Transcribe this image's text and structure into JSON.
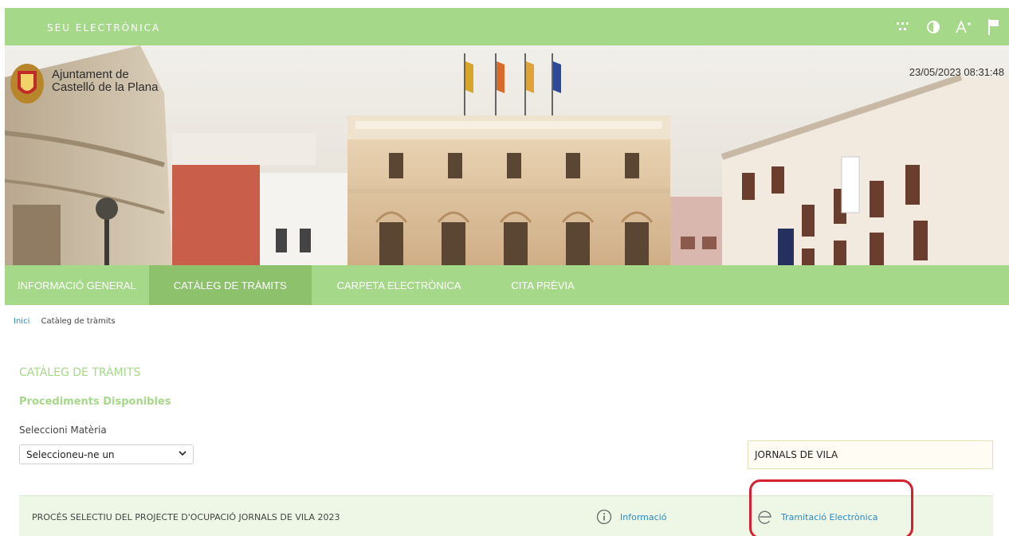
{
  "topbar": {
    "title": "SEU ELECTRÒNICA",
    "icons": [
      "sitemap-icon",
      "contrast-icon",
      "font-size-icon",
      "flag-icon"
    ],
    "color": "#a6d889"
  },
  "banner": {
    "logo_line1": "Ajuntament de",
    "logo_line2": "Castelló de la Plana",
    "datetime": "23/05/2023 08:31:48"
  },
  "nav": {
    "items": [
      {
        "label": "INFORMACIÓ GENERAL",
        "active": false
      },
      {
        "label": "CATÀLEG DE TRÀMITS",
        "active": true
      },
      {
        "label": "CARPETA ELECTRÒNICA",
        "active": false
      },
      {
        "label": "CITA PRÈVIA",
        "active": false
      }
    ]
  },
  "breadcrumb": {
    "home": "Inici",
    "current": "Catàleg de tràmits"
  },
  "main": {
    "heading": "CATÀLEG DE TRÀMITS",
    "subheading": "Procediments Disponibles",
    "select_label": "Seleccioni Matèria",
    "select_value": "Seleccioneu-ne un",
    "search_value": "JORNALS DE VILA"
  },
  "results": [
    {
      "title": "PROCÉS SELECTIU DEL PROJECTE D'OCUPACIÓ JORNALS DE VILA 2023",
      "info_label": "Informació",
      "tram_label": "Tramitació Electrònica"
    }
  ]
}
